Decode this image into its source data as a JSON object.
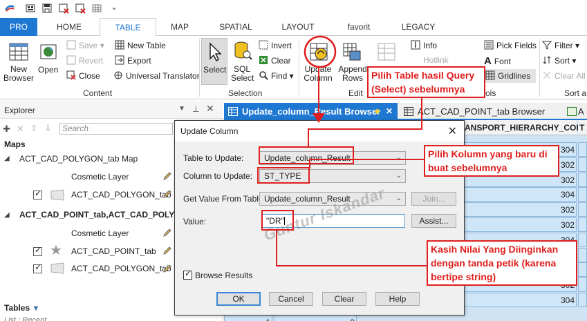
{
  "tabs": [
    "PRO",
    "HOME",
    "TABLE",
    "MAP",
    "SPATIAL",
    "LAYOUT",
    "favorit",
    "LEGACY"
  ],
  "ribbon": {
    "new_browser": "New Browser",
    "open": "Open",
    "save": "Save",
    "revert": "Revert",
    "close": "Close",
    "new_table": "New Table",
    "export": "Export",
    "universal_translator": "Universal Translator",
    "content_label": "Content",
    "select": "Select",
    "sql_select": "SQL Select",
    "invert": "Invert",
    "clear": "Clear",
    "find": "Find",
    "selection_label": "Selection",
    "update_column": "Update Column",
    "append_rows": "Append Rows",
    "edit_label": "Edit",
    "info": "Info",
    "hotlink": "Hotlink",
    "pick_fields": "Pick Fields",
    "font": "Font",
    "gridlines": "Gridlines",
    "tools_label": "ols",
    "filter": "Filter",
    "sort": "Sort",
    "clear_all": "Clear All",
    "sort_label": "Sort a"
  },
  "explorer": {
    "title": "Explorer",
    "search_placeholder": "Search",
    "maps_header": "Maps",
    "map1": "ACT_CAD_POLYGON_tab Map",
    "map1_cosmetic": "Cosmetic Layer",
    "map1_layer": "ACT_CAD_POLYGON_tab",
    "map2": "ACT_CAD_POINT_tab,ACT_CAD_POLYGON",
    "map2_cosmetic": "Cosmetic Layer",
    "map2_layer1": "ACT_CAD_POINT_tab",
    "map2_layer2": "ACT_CAD_POLYGON_tab",
    "tables_header": "Tables",
    "list_recent": "List : Recent"
  },
  "view_tabs": {
    "active": "Update_column_Result Browser",
    "second": "ACT_CAD_POINT_tab Browser",
    "third": "A"
  },
  "table": {
    "header_col": "ANSPORT_HIERARCHY_CODE",
    "header_next": "T",
    "values": [
      "304",
      "302",
      "302",
      "304",
      "302",
      "302",
      "304",
      "304",
      "304",
      "302",
      "304"
    ],
    "bottom_left": "1",
    "bottom_mid": "0"
  },
  "dialog": {
    "title": "Update Column",
    "table_to_update_label": "Table to Update:",
    "table_to_update_value": "Update_column_Result",
    "column_to_update_label": "Column to Update:",
    "column_to_update_value": "ST_TYPE",
    "get_value_label": "Get Value From Table:",
    "get_value_value": "Update_column_Result",
    "join_button": "Join...",
    "value_label": "Value:",
    "value_value": "\"DR\"",
    "assist_button": "Assist...",
    "browse_results": "Browse Results",
    "ok": "OK",
    "cancel": "Cancel",
    "clear": "Clear",
    "help": "Help"
  },
  "annotations": {
    "note1": "Pilih Table hasil Query (Select) sebelumnya",
    "note2": "Pilih Kolumn yang baru di buat sebelumnya",
    "note3": "Kasih Nilai Yang Diinginkan dengan tanda petik (karena bertipe string)",
    "watermark": "Guntur Iskandar"
  },
  "colors": {
    "accent": "#1e78d2",
    "annotation": "#e01e1e"
  }
}
